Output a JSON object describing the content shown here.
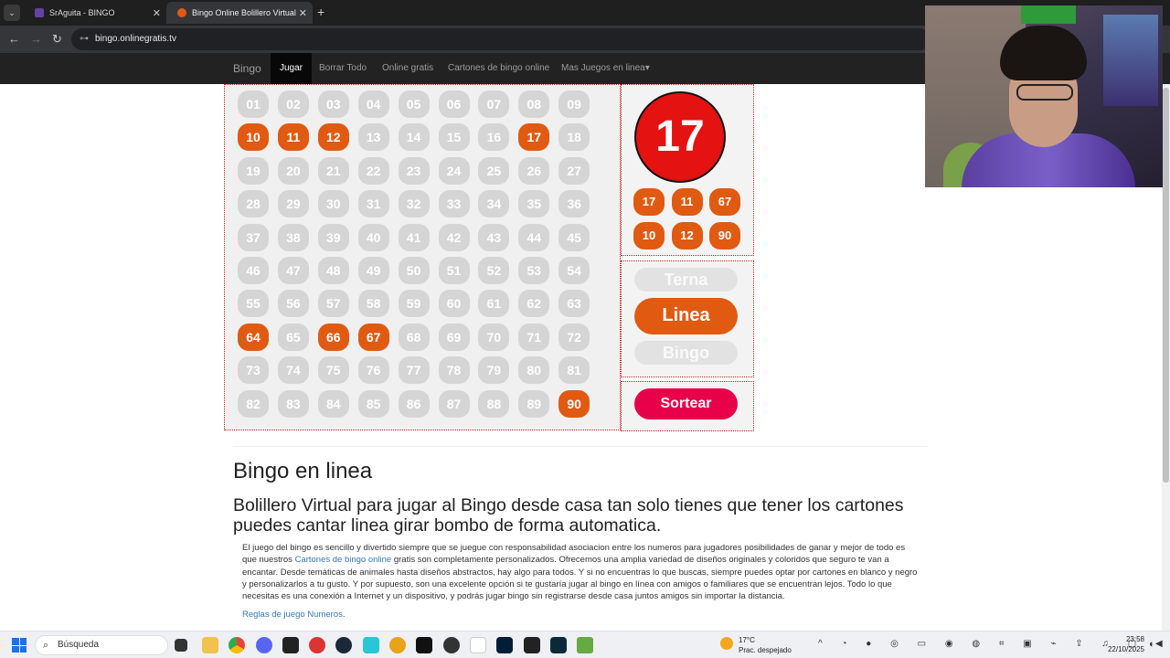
{
  "browser": {
    "tabs": [
      {
        "title": "SrAguita - BINGO",
        "active": false,
        "favicon_color": "#6441a5"
      },
      {
        "title": "Bingo Online Bolillero Virtual",
        "active": true,
        "favicon_color": "#e05a12"
      }
    ],
    "new_tab": "+",
    "tab_menu": "⌄",
    "url": "bingo.onlinegratis.tv",
    "back": "←",
    "forward": "→",
    "reload": "↻",
    "tune": "⊶",
    "close": "✕"
  },
  "nav": {
    "brand": "Bingo",
    "items": [
      "Jugar",
      "Borrar Todo",
      "Online gratis",
      "Cartones de bingo online",
      "Mas Juegos en linea"
    ],
    "dropdown_caret": "▾"
  },
  "board": {
    "numbers": [
      "01",
      "02",
      "03",
      "04",
      "05",
      "06",
      "07",
      "08",
      "09",
      "10",
      "11",
      "12",
      "13",
      "14",
      "15",
      "16",
      "17",
      "18",
      "19",
      "20",
      "21",
      "22",
      "23",
      "24",
      "25",
      "26",
      "27",
      "28",
      "29",
      "30",
      "31",
      "32",
      "33",
      "34",
      "35",
      "36",
      "37",
      "38",
      "39",
      "40",
      "41",
      "42",
      "43",
      "44",
      "45",
      "46",
      "47",
      "48",
      "49",
      "50",
      "51",
      "52",
      "53",
      "54",
      "55",
      "56",
      "57",
      "58",
      "59",
      "60",
      "61",
      "62",
      "63",
      "64",
      "65",
      "66",
      "67",
      "68",
      "69",
      "70",
      "71",
      "72",
      "73",
      "74",
      "75",
      "76",
      "77",
      "78",
      "79",
      "80",
      "81",
      "82",
      "83",
      "84",
      "85",
      "86",
      "87",
      "88",
      "89",
      "90"
    ],
    "drawn": [
      "10",
      "11",
      "12",
      "17",
      "64",
      "66",
      "67",
      "90"
    ]
  },
  "current": {
    "number": "17",
    "last_drawn": [
      "17",
      "11",
      "67",
      "10",
      "12",
      "90"
    ]
  },
  "modes": {
    "terna": "Terna",
    "linea": "Linea",
    "bingo": "Bingo",
    "selected": "Linea"
  },
  "draw_button": "Sortear",
  "content": {
    "h1": "Bingo en linea",
    "h2": "Bolillero Virtual para jugar al Bingo desde casa tan solo tienes que tener los cartones puedes cantar linea girar bombo de forma automatica.",
    "p_before_link": "El juego del bingo es sencillo y divertido siempre que se juegue con responsabilidad asociacion entre los numeros para jugadores posibilidades de ganar y mejor de todo es que nuestros ",
    "p_link": "Cartones de bingo online",
    "p_after_link": " gratis son completamente personalizados. Ofrecemos una amplia variedad de diseños originales y coloridos que seguro te van a encantar. Desde temáticas de animales hasta diseños abstractos, hay algo para todos. Y si no encuentras lo que buscas, siempre puedes optar por cartones en blanco y negro y personalizarlos a tu gusto. Y por supuesto, son una excelente opción si te gustaría jugar al bingo en línea con amigos o familiares que se encuentran lejos. Todo lo que necesitas es una conexión a Internet y un dispositivo, y podrás jugar bingo sin registrarse desde casa juntos amigos sin importar la distancia.",
    "rules_link": "Reglas de juego Numeros",
    "rules_suffix": "."
  },
  "taskbar": {
    "search_placeholder": "Búsqueda",
    "weather_temp": "17°C",
    "weather_desc": "Prac. despejado",
    "time": "23:58",
    "date": "22/10/2025",
    "tray_icons": "^ ◔ ● ◎ ▭ ◉ ◍ ⌗ ▣ ⌁ ⇪ ♫ ▢ ◀)",
    "notification": "◐"
  },
  "colors": {
    "drawn_ball": "#e05a12",
    "undrawn_ball": "#d5d5d5",
    "big_ball": "#e51212",
    "draw_button": "#e8004a",
    "board_border": "#b22222"
  }
}
